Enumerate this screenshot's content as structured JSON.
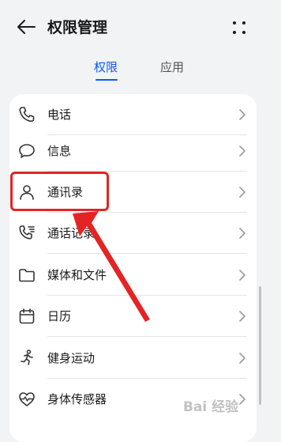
{
  "header": {
    "title": "权限管理"
  },
  "tabs": [
    {
      "label": "权限",
      "active": true
    },
    {
      "label": "应用",
      "active": false
    }
  ],
  "permissions": [
    {
      "label": "电话",
      "icon": "phone-icon"
    },
    {
      "label": "信息",
      "icon": "message-icon"
    },
    {
      "label": "通讯录",
      "icon": "contacts-icon"
    },
    {
      "label": "通话记录",
      "icon": "call-log-icon"
    },
    {
      "label": "媒体和文件",
      "icon": "folder-icon"
    },
    {
      "label": "日历",
      "icon": "calendar-icon"
    },
    {
      "label": "健身运动",
      "icon": "running-icon"
    },
    {
      "label": "身体传感器",
      "icon": "heart-sensor-icon"
    }
  ],
  "watermark": "Bai 经验",
  "colors": {
    "accent": "#0a59f7",
    "annotation": "#e42424",
    "background": "#f1f3f5"
  }
}
